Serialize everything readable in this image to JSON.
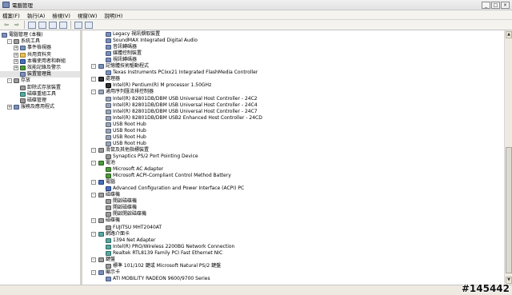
{
  "window": {
    "title": "電腦管理",
    "controls": [
      "_",
      "□",
      "×"
    ]
  },
  "menu": [
    "檔案(F)",
    "執行(A)",
    "檢視(V)",
    "視窗(W)",
    "說明(H)"
  ],
  "toolbar": {
    "icons": [
      "back-arrow-icon",
      "forward-arrow-icon",
      "up-folder-icon",
      "tree-toggle-icon",
      "properties-icon",
      "print-icon",
      "help-icon",
      "show-hidden-icon"
    ]
  },
  "left_tree": [
    {
      "label": "電腦管理 (本機)",
      "indent": 0,
      "expander": "",
      "icon": "computer"
    },
    {
      "label": "系統工具",
      "indent": 1,
      "expander": "-",
      "icon": "tools"
    },
    {
      "label": "事件檢視器",
      "indent": 2,
      "expander": "+",
      "icon": "event"
    },
    {
      "label": "共用資料夾",
      "indent": 2,
      "expander": "+",
      "icon": "folder"
    },
    {
      "label": "本機使用者和群組",
      "indent": 2,
      "expander": "+",
      "icon": "users"
    },
    {
      "label": "效能記錄及警示",
      "indent": 2,
      "expander": "+",
      "icon": "perf"
    },
    {
      "label": "裝置管理員",
      "indent": 2,
      "expander": "",
      "icon": "device",
      "selected": true
    },
    {
      "label": "存放",
      "indent": 1,
      "expander": "-",
      "icon": "storage"
    },
    {
      "label": "卸除式存放裝置",
      "indent": 2,
      "expander": "",
      "icon": "removable"
    },
    {
      "label": "磁碟重組工具",
      "indent": 2,
      "expander": "",
      "icon": "defrag"
    },
    {
      "label": "磁碟管理",
      "indent": 2,
      "expander": "",
      "icon": "disk"
    },
    {
      "label": "服務及應用程式",
      "indent": 1,
      "expander": "+",
      "icon": "services"
    }
  ],
  "device_tree": [
    {
      "label": "Legacy 視訊擷取裝置",
      "level": 2,
      "icon": "dev"
    },
    {
      "label": "SoundMAX Integrated Digital Audio",
      "level": 2,
      "icon": "dev"
    },
    {
      "label": "音訊轉碼器",
      "level": 2,
      "icon": "dev"
    },
    {
      "label": "媒體控制裝置",
      "level": 2,
      "icon": "dev"
    },
    {
      "label": "視訊轉碼器",
      "level": 2,
      "icon": "dev"
    },
    {
      "label": "記憶體技術驅動程式",
      "level": 1,
      "icon": "dev"
    },
    {
      "label": "Texas Instruments PCIxx21 Integrated FlashMedia Controller",
      "level": 2,
      "icon": "dev"
    },
    {
      "label": "處理器",
      "level": 1,
      "icon": "dark"
    },
    {
      "label": "Intel(R) Pentium(R) M processor 1.50GHz",
      "level": 2,
      "icon": "dark"
    },
    {
      "label": "通用序列匯流排控制器",
      "level": 1,
      "icon": "usb"
    },
    {
      "label": "Intel(R) 82801DB/DBM USB Universal Host Controller - 24C2",
      "level": 2,
      "icon": "usb"
    },
    {
      "label": "Intel(R) 82801DB/DBM USB Universal Host Controller - 24C4",
      "level": 2,
      "icon": "usb"
    },
    {
      "label": "Intel(R) 82801DB/DBM USB Universal Host Controller - 24C7",
      "level": 2,
      "icon": "usb"
    },
    {
      "label": "Intel(R) 82801DB/DBM USB2 Enhanced Host Controller - 24CD",
      "level": 2,
      "icon": "usb"
    },
    {
      "label": "USB Root Hub",
      "level": 2,
      "icon": "usb"
    },
    {
      "label": "USB Root Hub",
      "level": 2,
      "icon": "usb"
    },
    {
      "label": "USB Root Hub",
      "level": 2,
      "icon": "usb"
    },
    {
      "label": "USB Root Hub",
      "level": 2,
      "icon": "usb"
    },
    {
      "label": "滑鼠及其他指標裝置",
      "level": 1,
      "icon": "gray"
    },
    {
      "label": "Synaptics PS/2 Port Pointing Device",
      "level": 2,
      "icon": "gray"
    },
    {
      "label": "電池",
      "level": 1,
      "icon": "green"
    },
    {
      "label": "Microsoft AC Adapter",
      "level": 2,
      "icon": "green"
    },
    {
      "label": "Microsoft ACPI-Compliant Control Method Battery",
      "level": 2,
      "icon": "green"
    },
    {
      "label": "電腦",
      "level": 1,
      "icon": "blue"
    },
    {
      "label": "Advanced Configuration and Power Interface (ACPI) PC",
      "level": 2,
      "icon": "blue"
    },
    {
      "label": "磁碟機",
      "level": 1,
      "icon": "gray"
    },
    {
      "label": "開啟磁碟機",
      "level": 2,
      "icon": "gray"
    },
    {
      "label": "開啟磁碟機",
      "level": 2,
      "icon": "gray"
    },
    {
      "label": "開啟開啟磁碟機",
      "level": 2,
      "icon": "gray"
    },
    {
      "label": "磁碟機",
      "level": 1,
      "icon": "gray"
    },
    {
      "label": "FUJITSU MHT2040AT",
      "level": 2,
      "icon": "gray"
    },
    {
      "label": "網路介面卡",
      "level": 1,
      "icon": "teal"
    },
    {
      "label": "1394 Net Adapter",
      "level": 2,
      "icon": "teal"
    },
    {
      "label": "Intel(R) PRO/Wireless 2200BG Network Connection",
      "level": 2,
      "icon": "teal"
    },
    {
      "label": "Realtek RTL8139 Family PCI Fast Ethernet NIC",
      "level": 2,
      "icon": "teal"
    },
    {
      "label": "鍵盤",
      "level": 1,
      "icon": "gray"
    },
    {
      "label": "標準 101/102 鍵或 Microsoft Natural PS/2 鍵盤",
      "level": 2,
      "icon": "gray"
    },
    {
      "label": "顯示卡",
      "level": 1,
      "icon": "dev"
    },
    {
      "label": "ATI MOBILITY RADEON 9600/9700 Series",
      "level": 2,
      "icon": "dev"
    }
  ],
  "watermark": "#145442"
}
